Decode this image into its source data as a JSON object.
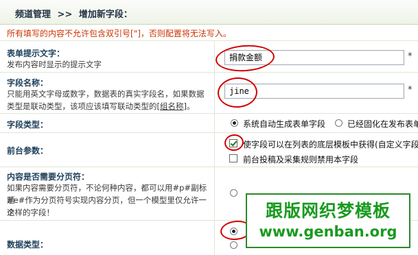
{
  "breadcrumb": {
    "part1": "频道管理",
    "sep": ">>",
    "part2": "增加新字段："
  },
  "notice": "所有填写的内容不允许包含双引号[\"]，否则配置将无法写入。",
  "form": {
    "tip": {
      "title": "表单提示文字：",
      "desc": "发布内容时显示的提示文字",
      "value": "捐款金额",
      "required_mark": "*"
    },
    "field_name": {
      "title": "字段名称：",
      "desc_line1": "只能用英文字母或数字，数据表的真实字段名，如果数据",
      "desc_line2_prefix": "类型是联动类型，该项应该填写联动类型的",
      "desc_link": "[组名称]",
      "desc_line2_suffix": "。",
      "value": "jine",
      "required_mark": "*"
    },
    "field_type": {
      "title": "字段类型：",
      "option1": "系统自动生成表单字段",
      "option2": "已经固化在发布表单"
    },
    "frontend": {
      "title": "前台参数：",
      "check1": "使字段可以在列表的底层模板中获得(自定义字段",
      "check2": "前台投稿及采集规则禁用本字段"
    },
    "paging": {
      "title": "内容是否需要分页符：",
      "desc_line1": "如果内容需要分页符，不论何种内容，都可以用#p#副标题",
      "desc_line2": "#e#作为分页符号实现内容分页，但一个模型里仅允许一个",
      "desc_line3": "这样的字段！"
    },
    "data_type": {
      "title": "数据类型："
    }
  },
  "watermark": {
    "line1": "跟版网织梦模板",
    "line2": "www.genban.org"
  }
}
